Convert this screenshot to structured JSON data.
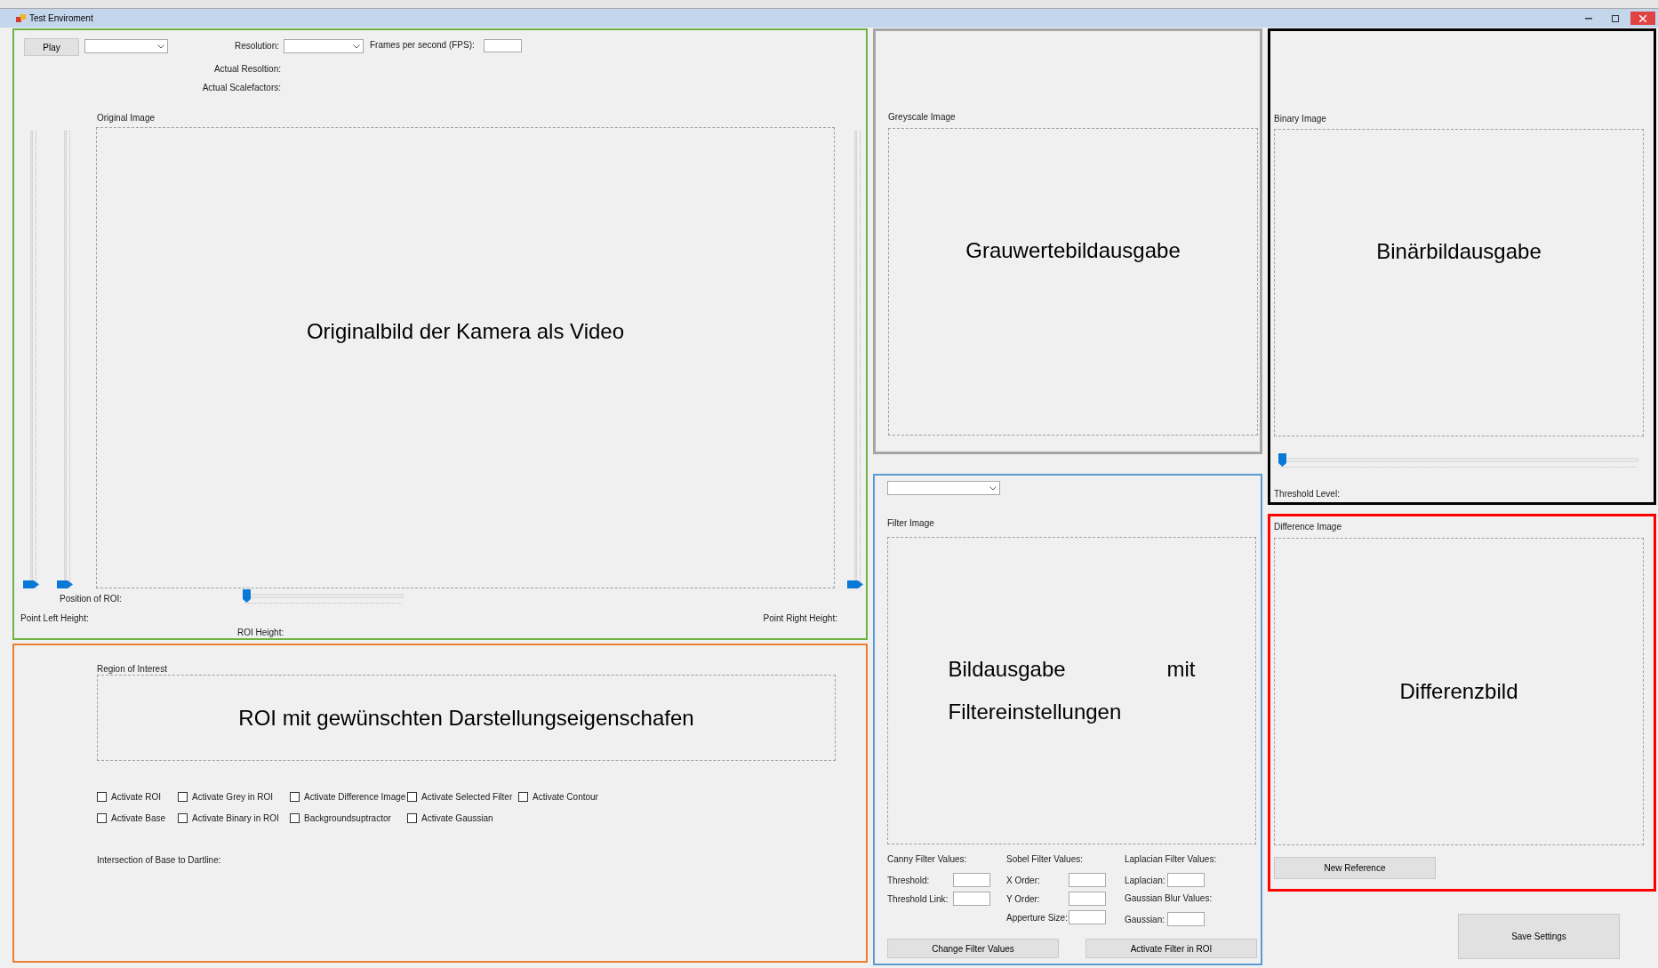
{
  "window": {
    "title": "Test Enviroment"
  },
  "video_panel": {
    "play_button": "Play",
    "resolution_label": "Resolution:",
    "fps_label": "Frames per second (FPS):",
    "actual_resolution_label": "Actual Resoltion:",
    "actual_scalefactors_label": "Actual Scalefactors:",
    "image_label": "Original Image",
    "image_caption": "Originalbild der Kamera als Video",
    "vertical_sliders": [
      {
        "level": 0
      },
      {
        "level": 0
      },
      {
        "level": 0
      }
    ],
    "position_label": "Position of ROI:",
    "roi_slider": {
      "level": 0
    },
    "point_left_label": "Point Left Height:",
    "roi_height_label": "ROI Height:",
    "point_right_label": "Point Right Height:"
  },
  "roi_panel": {
    "label": "Region of Interest",
    "caption": "ROI mit gewünschten Darstellungseigenschafen",
    "checkboxes": [
      {
        "label": "Activate ROI",
        "checked": false
      },
      {
        "label": "Activate Grey in ROI",
        "checked": false
      },
      {
        "label": "Activate Difference Image",
        "checked": false
      },
      {
        "label": "Activate Selected Filter",
        "checked": false
      },
      {
        "label": "Activate Contour",
        "checked": false
      },
      {
        "label": "Activate Base",
        "checked": false
      },
      {
        "label": "Activate Binary in ROI",
        "checked": false
      },
      {
        "label": "Backgroundsuptractor",
        "checked": false
      },
      {
        "label": "Activate Gaussian",
        "checked": false
      }
    ],
    "intersection_label": "Intersection of Base to Dartline:"
  },
  "greyscale_panel": {
    "label": "Greyscale Image",
    "caption": "Grauwertebildausgabe"
  },
  "binary_panel": {
    "label": "Binary Image",
    "caption": "Binärbildausgabe",
    "threshold_slider": {
      "level": 0
    },
    "threshold_label": "Threshold Level:"
  },
  "filter_panel": {
    "label": "Filter Image",
    "caption": "Bildausgabe mit Filtereinstellungen",
    "groups": [
      {
        "items": [
          {
            "kind": "heading",
            "text": "Canny Filter Values:"
          },
          {
            "kind": "field",
            "text": "Threshold:"
          },
          {
            "kind": "field",
            "text": "Threshold Link:"
          }
        ]
      },
      {
        "items": [
          {
            "kind": "heading",
            "text": "Sobel Filter Values:"
          },
          {
            "kind": "field",
            "text": "X Order:"
          },
          {
            "kind": "field",
            "text": "Y Order:"
          },
          {
            "kind": "field",
            "text": "Apperture Size:"
          }
        ]
      },
      {
        "items": [
          {
            "kind": "heading",
            "text": "Laplacian Filter Values:"
          },
          {
            "kind": "field",
            "text": "Laplacian:"
          },
          {
            "kind": "heading",
            "text": "Gaussian Blur Values:"
          },
          {
            "kind": "field",
            "text": "Gaussian:"
          }
        ]
      }
    ],
    "buttons": [
      "Change Filter Values",
      "Activate Filter in ROI"
    ]
  },
  "difference_panel": {
    "label": "Difference Image",
    "caption": "Differenzbild",
    "button": "New Reference"
  },
  "save_button": "Save Settings"
}
